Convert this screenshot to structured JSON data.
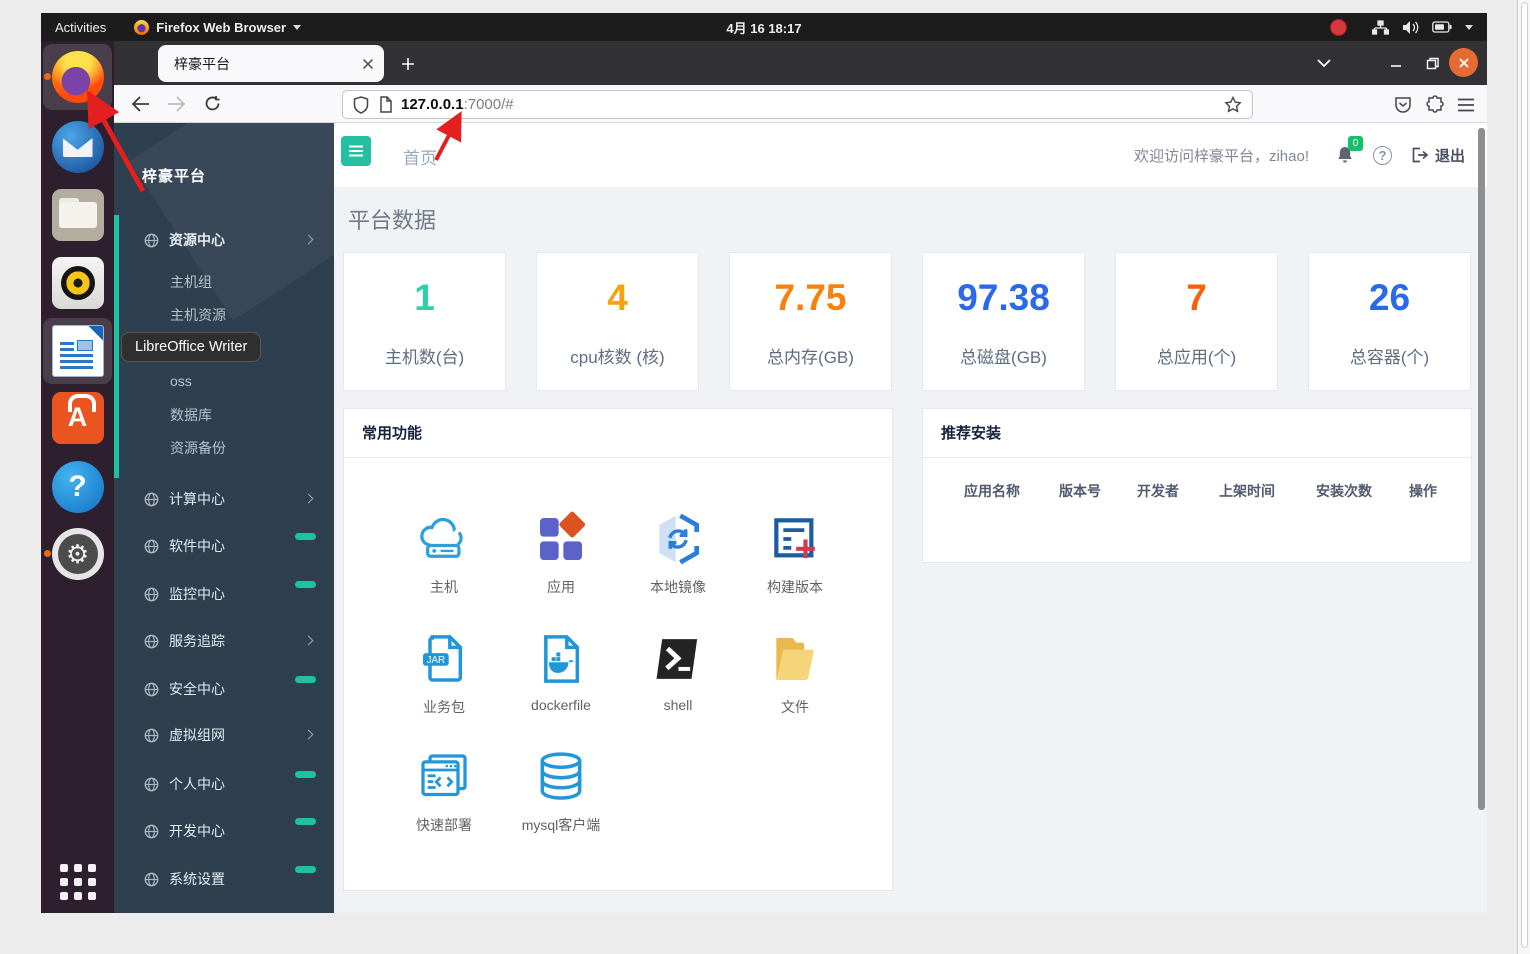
{
  "system_bar": {
    "activities": "Activities",
    "app_name": "Firefox Web Browser",
    "clock": "4月 16 18:17",
    "status_icons": [
      "record-dot-icon",
      "network-icon",
      "volume-icon",
      "battery-icon",
      "chevron-down-icon"
    ]
  },
  "dock": {
    "tooltip": "LibreOffice Writer",
    "items": [
      "firefox",
      "thunderbird",
      "files",
      "rhythmbox",
      "libreoffice-writer",
      "ubuntu-software",
      "help",
      "settings",
      "show-applications"
    ]
  },
  "browser": {
    "tab_title": "梓豪平台",
    "url_host": "127.0.0.1",
    "url_rest": ":7000/#",
    "toolbar_icons": [
      "back-icon",
      "forward-icon",
      "reload-icon",
      "shield-icon",
      "page-icon",
      "bookmark-star-icon",
      "pocket-icon",
      "extensions-icon",
      "menu-icon"
    ]
  },
  "sidebar": {
    "title": "梓豪平台",
    "resource_section": {
      "label": "资源中心"
    },
    "resource_children": [
      "主机组",
      "主机资源",
      "",
      "oss",
      "数据库",
      "资源备份"
    ],
    "sections": [
      {
        "label": "计算中心",
        "indicator": "arrow"
      },
      {
        "label": "软件中心",
        "indicator": "pill"
      },
      {
        "label": "监控中心",
        "indicator": "pill"
      },
      {
        "label": "服务追踪",
        "indicator": "arrow"
      },
      {
        "label": "安全中心",
        "indicator": "pill"
      },
      {
        "label": "虚拟组网",
        "indicator": "arrow"
      },
      {
        "label": "个人中心",
        "indicator": "pill"
      },
      {
        "label": "开发中心",
        "indicator": "pill"
      },
      {
        "label": "系统设置",
        "indicator": "pill"
      }
    ],
    "accent_color": "#1ec2a3"
  },
  "header": {
    "breadcrumb": "首页",
    "welcome": "欢迎访问梓豪平台，zihao!",
    "notification_count": "0",
    "logout_label": "退出"
  },
  "stats": {
    "title": "平台数据",
    "cards": [
      {
        "value": "1",
        "label": "主机数(台)",
        "color": "#2dd1a5"
      },
      {
        "value": "4",
        "label": "cpu核数 (核)",
        "color": "#f8a20f"
      },
      {
        "value": "7.75",
        "label": "总内存(GB)",
        "color": "#f8800f"
      },
      {
        "value": "97.38",
        "label": "总磁盘(GB)",
        "color": "#2a6ae9"
      },
      {
        "value": "7",
        "label": "总应用(个)",
        "color": "#f6610c"
      },
      {
        "value": "26",
        "label": "总容器(个)",
        "color": "#2a6ae9"
      }
    ]
  },
  "features": {
    "title": "常用功能",
    "jar_badge": "JAR",
    "items": [
      "主机",
      "应用",
      "本地镜像",
      "构建版本",
      "业务包",
      "dockerfile",
      "shell",
      "文件",
      "快速部署",
      "mysql客户端"
    ]
  },
  "recommend": {
    "title": "推荐安装",
    "columns": [
      "应用名称",
      "版本号",
      "开发者",
      "上架时间",
      "安装次数",
      "操作"
    ]
  }
}
